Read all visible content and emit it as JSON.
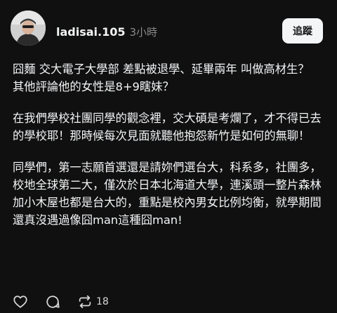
{
  "post": {
    "username": "ladisai.105",
    "timestamp": "3小時",
    "follow_label": "追蹤",
    "paragraphs": [
      {
        "lines": [
          "囧麵 交大電子大學部 差點被退學、延畢兩年 叫做高材生？",
          "其他評論他的女性是8+9瞎妹？"
        ]
      },
      {
        "lines": [
          "在我們學校社團同學的觀念裡，交大碩是考爛了，才不得已去的學校耶！那時候每次見面就聽他抱怨新竹是如何的無聊！"
        ]
      },
      {
        "lines": [
          "同學們，第一志願首選還是請妳們選台大，科系多，社團多，校地全球第二大，僅次於日本北海道大學，連溪頭一整片森林加小木屋也都是台大的，重點是校內男女比例均衡，就學期間還真沒遇過像囧man這種囧man!"
        ]
      }
    ]
  },
  "actions": {
    "like_icon": "heart-icon",
    "reply_icon": "comment-icon",
    "repost_icon": "repost-icon",
    "repost_count": "18"
  }
}
